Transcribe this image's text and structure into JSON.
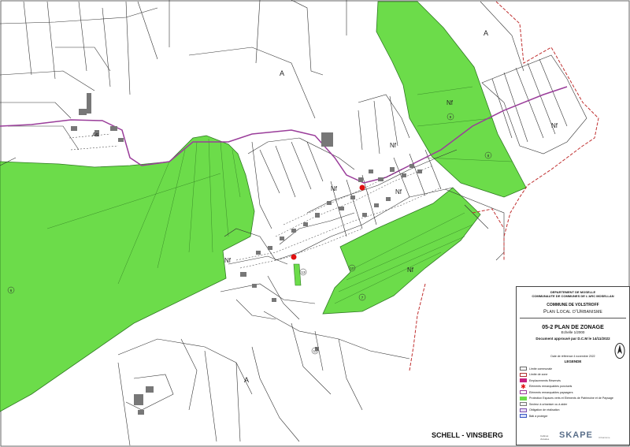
{
  "colors": {
    "zone_green": "#6cdc4a",
    "zone_green_dark": "#3fa52a",
    "road_purple": "#9a3d9a",
    "building_grey": "#777777",
    "parcel_line": "#333333",
    "marker_red": "#e01010",
    "boundary_red": "#c03030"
  },
  "map": {
    "zone_labels": {
      "a_north": "A",
      "a_top_right": "A",
      "a_bottom": "A",
      "nf_top": "Nf",
      "nf_east": "Nf",
      "nf_center_a": "Nf",
      "nf_center_b": "Nf",
      "nf_center_c": "Nf",
      "nf_west": "Nf",
      "nf_south": "Nf",
      "as": "As"
    },
    "circled_numbers": {
      "west": "6",
      "south_a": "7",
      "south_b": "10",
      "center": "13",
      "east": "8",
      "north": "9",
      "bottom": "11"
    }
  },
  "cartouche": {
    "department": "DEPARTEMENT DE MOSELLE",
    "community": "COMMUNAUTE DE COMMUNES DE L'ARC MOSELLAN",
    "commune": "COMMUNE DE VOLSTROFF",
    "plan_title": "Plan Local d'Urbanisme",
    "document_number_title": "05-2  PLAN DE ZONAGE",
    "scale": "Echelle 1/2000",
    "approval": "Document approuvé par D.C.M le 14/11/2022",
    "reference_note": "Date de référence 4 novembre 2022",
    "legend_title": "LEGENDE",
    "legend_items": [
      {
        "symbol": "perim",
        "label": "Limite communale"
      },
      {
        "symbol": "ebc",
        "label": "Limite de zone"
      },
      {
        "symbol": "er",
        "label": "Emplacements Réservés"
      },
      {
        "symbol": "star",
        "label": "Eléments remarquables ponctuels"
      },
      {
        "symbol": "ep",
        "label": "Eléments remarquables paysagers"
      },
      {
        "symbol": "eps",
        "label": "Protection Espaces verts et Eléments de Patrimoine et de Paysage"
      },
      {
        "symbol": "ppu",
        "label": "Secteur à urbaniser ou à aider"
      },
      {
        "symbol": "su",
        "label": "Obligation de réalisation"
      },
      {
        "symbol": "obl",
        "label": "Bâti à protéger"
      }
    ],
    "logo_name": "SKAPE",
    "logo_left": "Cabinet d'études",
    "logo_sub": "Urbanisme"
  },
  "footer": {
    "sheet_name": "SCHELL - VINSBERG"
  }
}
